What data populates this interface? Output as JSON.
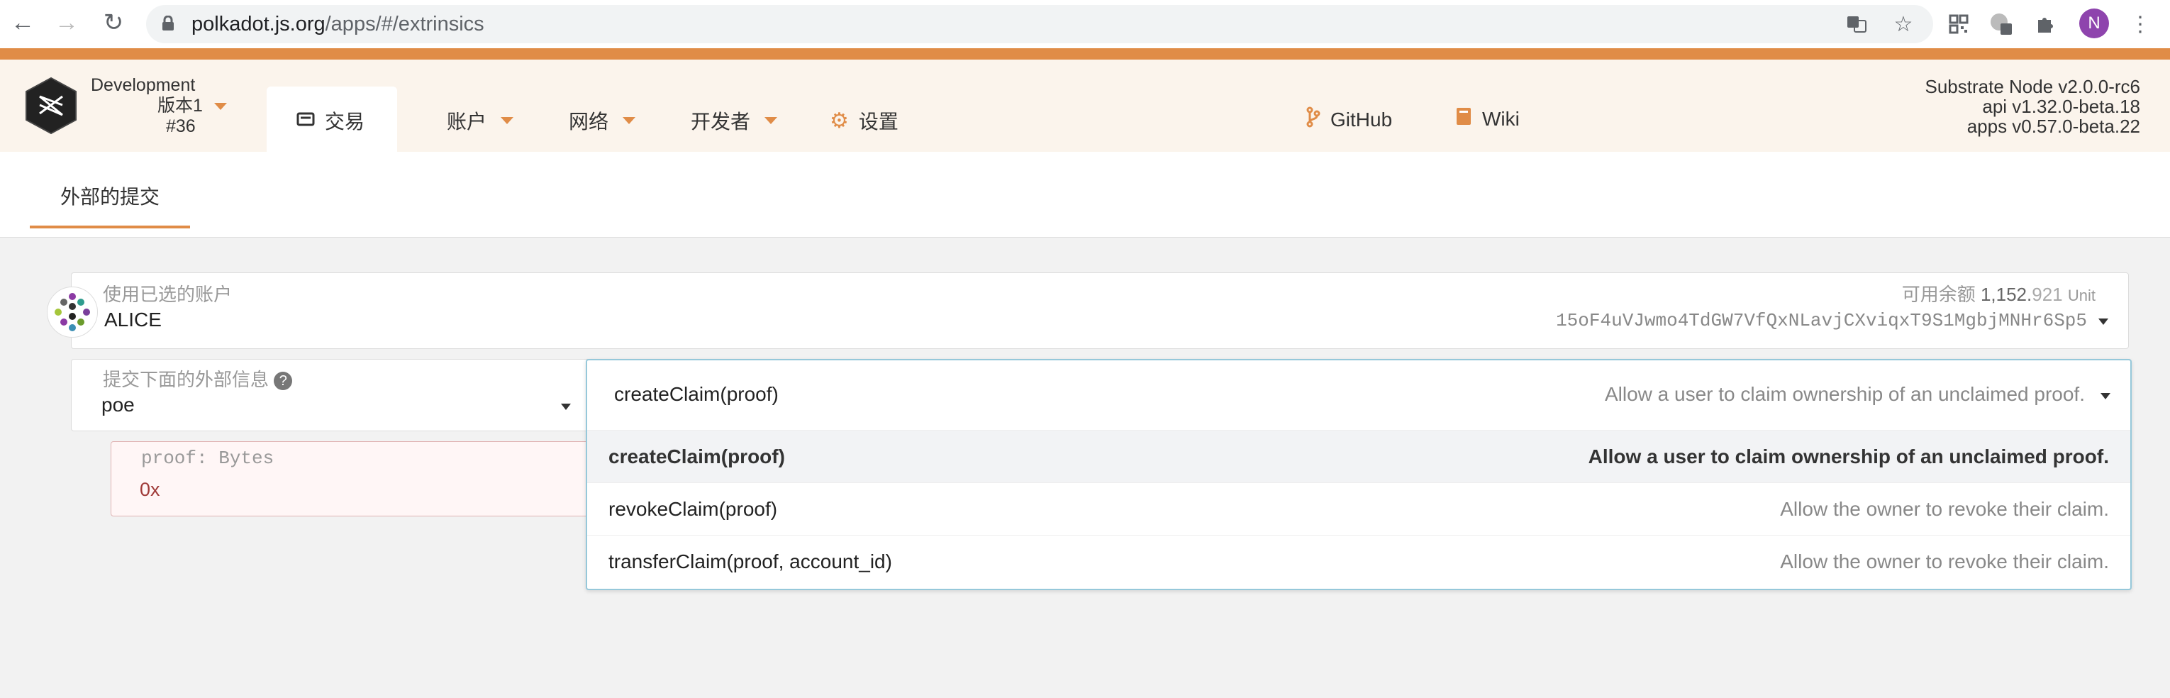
{
  "browser": {
    "url_host": "polkadot.js.org",
    "url_path": "/apps/#/extrinsics",
    "profile_initial": "N"
  },
  "colors": {
    "accent": "#e08c47",
    "header_bg": "#fbf4ec",
    "dropdown_border": "#96c8da"
  },
  "chain": {
    "name": "Development",
    "version_label": "版本1",
    "block": "#36"
  },
  "menu": {
    "tx": "交易",
    "accounts": "账户",
    "network": "网络",
    "developer": "开发者",
    "settings": "设置",
    "github": "GitHub",
    "wiki": "Wiki"
  },
  "node_version": {
    "substrate": "Substrate Node v2.0.0-rc6",
    "api": "api v1.32.0-beta.18",
    "apps": "apps v0.57.0-beta.22"
  },
  "tabs": {
    "extrinsics": "外部的提交"
  },
  "account": {
    "label": "使用已选的账户",
    "name": "ALICE",
    "balance_label": "可用余额",
    "balance_int": "1,152.",
    "balance_frac": "921",
    "balance_unit": "Unit",
    "address": "15oF4uVJwmo4TdGW7VfQxNLavjCXviqxT9S1MgbjMNHr6Sp5"
  },
  "extrinsic": {
    "label": "提交下面的外部信息",
    "module": "poe",
    "selected_call": "createClaim(proof)",
    "selected_desc": "Allow a user to claim ownership of an unclaimed proof.",
    "options": [
      {
        "name": "createClaim(proof)",
        "desc": "Allow a user to claim ownership of an unclaimed proof."
      },
      {
        "name": "revokeClaim(proof)",
        "desc": "Allow the owner to revoke their claim."
      },
      {
        "name": "transferClaim(proof, account_id)",
        "desc": "Allow the owner to revoke their claim."
      }
    ]
  },
  "param": {
    "label": "proof: Bytes",
    "value": "0x"
  }
}
